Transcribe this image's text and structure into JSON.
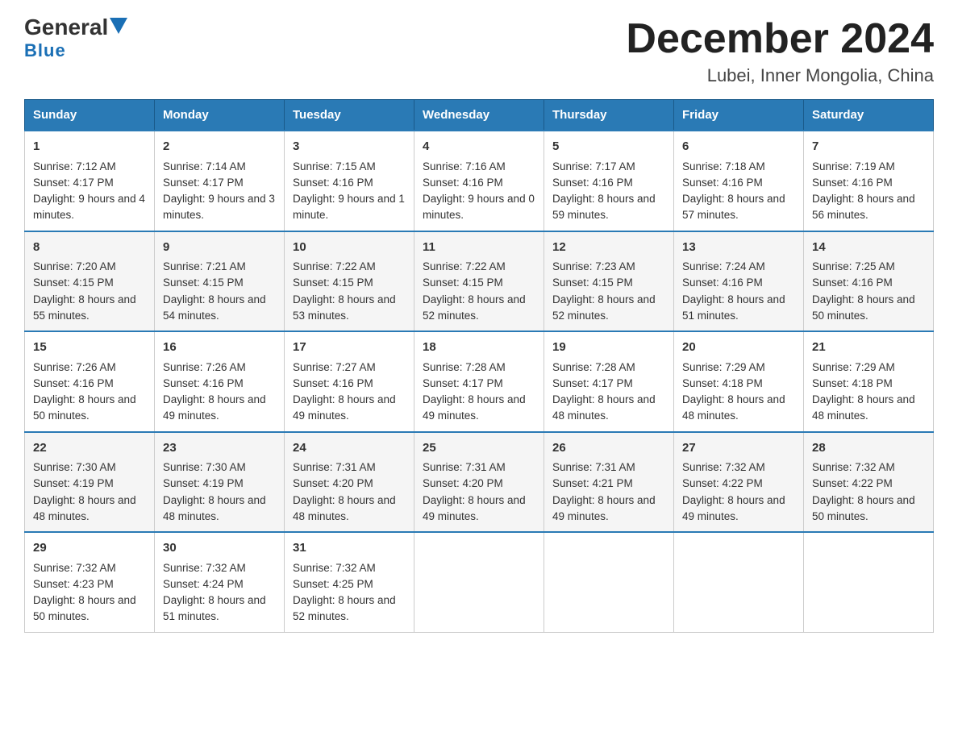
{
  "logo": {
    "text1": "General",
    "text2": "Blue"
  },
  "title": "December 2024",
  "subtitle": "Lubei, Inner Mongolia, China",
  "days": [
    "Sunday",
    "Monday",
    "Tuesday",
    "Wednesday",
    "Thursday",
    "Friday",
    "Saturday"
  ],
  "weeks": [
    [
      {
        "num": "1",
        "sunrise": "7:12 AM",
        "sunset": "4:17 PM",
        "daylight": "9 hours and 4 minutes."
      },
      {
        "num": "2",
        "sunrise": "7:14 AM",
        "sunset": "4:17 PM",
        "daylight": "9 hours and 3 minutes."
      },
      {
        "num": "3",
        "sunrise": "7:15 AM",
        "sunset": "4:16 PM",
        "daylight": "9 hours and 1 minute."
      },
      {
        "num": "4",
        "sunrise": "7:16 AM",
        "sunset": "4:16 PM",
        "daylight": "9 hours and 0 minutes."
      },
      {
        "num": "5",
        "sunrise": "7:17 AM",
        "sunset": "4:16 PM",
        "daylight": "8 hours and 59 minutes."
      },
      {
        "num": "6",
        "sunrise": "7:18 AM",
        "sunset": "4:16 PM",
        "daylight": "8 hours and 57 minutes."
      },
      {
        "num": "7",
        "sunrise": "7:19 AM",
        "sunset": "4:16 PM",
        "daylight": "8 hours and 56 minutes."
      }
    ],
    [
      {
        "num": "8",
        "sunrise": "7:20 AM",
        "sunset": "4:15 PM",
        "daylight": "8 hours and 55 minutes."
      },
      {
        "num": "9",
        "sunrise": "7:21 AM",
        "sunset": "4:15 PM",
        "daylight": "8 hours and 54 minutes."
      },
      {
        "num": "10",
        "sunrise": "7:22 AM",
        "sunset": "4:15 PM",
        "daylight": "8 hours and 53 minutes."
      },
      {
        "num": "11",
        "sunrise": "7:22 AM",
        "sunset": "4:15 PM",
        "daylight": "8 hours and 52 minutes."
      },
      {
        "num": "12",
        "sunrise": "7:23 AM",
        "sunset": "4:15 PM",
        "daylight": "8 hours and 52 minutes."
      },
      {
        "num": "13",
        "sunrise": "7:24 AM",
        "sunset": "4:16 PM",
        "daylight": "8 hours and 51 minutes."
      },
      {
        "num": "14",
        "sunrise": "7:25 AM",
        "sunset": "4:16 PM",
        "daylight": "8 hours and 50 minutes."
      }
    ],
    [
      {
        "num": "15",
        "sunrise": "7:26 AM",
        "sunset": "4:16 PM",
        "daylight": "8 hours and 50 minutes."
      },
      {
        "num": "16",
        "sunrise": "7:26 AM",
        "sunset": "4:16 PM",
        "daylight": "8 hours and 49 minutes."
      },
      {
        "num": "17",
        "sunrise": "7:27 AM",
        "sunset": "4:16 PM",
        "daylight": "8 hours and 49 minutes."
      },
      {
        "num": "18",
        "sunrise": "7:28 AM",
        "sunset": "4:17 PM",
        "daylight": "8 hours and 49 minutes."
      },
      {
        "num": "19",
        "sunrise": "7:28 AM",
        "sunset": "4:17 PM",
        "daylight": "8 hours and 48 minutes."
      },
      {
        "num": "20",
        "sunrise": "7:29 AM",
        "sunset": "4:18 PM",
        "daylight": "8 hours and 48 minutes."
      },
      {
        "num": "21",
        "sunrise": "7:29 AM",
        "sunset": "4:18 PM",
        "daylight": "8 hours and 48 minutes."
      }
    ],
    [
      {
        "num": "22",
        "sunrise": "7:30 AM",
        "sunset": "4:19 PM",
        "daylight": "8 hours and 48 minutes."
      },
      {
        "num": "23",
        "sunrise": "7:30 AM",
        "sunset": "4:19 PM",
        "daylight": "8 hours and 48 minutes."
      },
      {
        "num": "24",
        "sunrise": "7:31 AM",
        "sunset": "4:20 PM",
        "daylight": "8 hours and 48 minutes."
      },
      {
        "num": "25",
        "sunrise": "7:31 AM",
        "sunset": "4:20 PM",
        "daylight": "8 hours and 49 minutes."
      },
      {
        "num": "26",
        "sunrise": "7:31 AM",
        "sunset": "4:21 PM",
        "daylight": "8 hours and 49 minutes."
      },
      {
        "num": "27",
        "sunrise": "7:32 AM",
        "sunset": "4:22 PM",
        "daylight": "8 hours and 49 minutes."
      },
      {
        "num": "28",
        "sunrise": "7:32 AM",
        "sunset": "4:22 PM",
        "daylight": "8 hours and 50 minutes."
      }
    ],
    [
      {
        "num": "29",
        "sunrise": "7:32 AM",
        "sunset": "4:23 PM",
        "daylight": "8 hours and 50 minutes."
      },
      {
        "num": "30",
        "sunrise": "7:32 AM",
        "sunset": "4:24 PM",
        "daylight": "8 hours and 51 minutes."
      },
      {
        "num": "31",
        "sunrise": "7:32 AM",
        "sunset": "4:25 PM",
        "daylight": "8 hours and 52 minutes."
      },
      null,
      null,
      null,
      null
    ]
  ],
  "labels": {
    "sunrise": "Sunrise:",
    "sunset": "Sunset:",
    "daylight": "Daylight:"
  }
}
